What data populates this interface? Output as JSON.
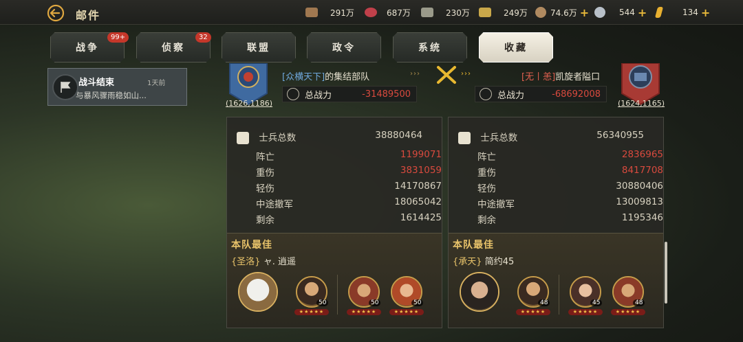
{
  "header": {
    "title": "邮件"
  },
  "resources": [
    {
      "name": "wood-icon",
      "value": "291万",
      "color": "#a07850",
      "plus": false
    },
    {
      "name": "meat-icon",
      "value": "687万",
      "color": "#c0404a",
      "plus": false
    },
    {
      "name": "stone-icon",
      "value": "230万",
      "color": "#9a9a8a",
      "plus": false
    },
    {
      "name": "iron-icon",
      "value": "249万",
      "color": "#c9a84a",
      "plus": false
    },
    {
      "name": "copper-coin-icon",
      "value": "74.6万",
      "color": "#b08a60",
      "plus": true
    },
    {
      "name": "silver-coin-icon",
      "value": "544",
      "color": "#b8c0c8",
      "plus": true
    },
    {
      "name": "gold-ingot-icon",
      "value": "134",
      "color": "#e8b030",
      "plus": true
    }
  ],
  "tabs": [
    {
      "label": "战争",
      "badge": "99+"
    },
    {
      "label": "侦察",
      "badge": "32"
    },
    {
      "label": "联盟",
      "badge": ""
    },
    {
      "label": "政令",
      "badge": ""
    },
    {
      "label": "系统",
      "badge": ""
    },
    {
      "label": "收藏",
      "badge": ""
    }
  ],
  "mail": {
    "title": "战斗结束",
    "time": "1天前",
    "preview": "与暴风骤雨稳如山..."
  },
  "report": {
    "left": {
      "coords": "(1626,1186)",
      "guild_tag": "[众横天下]",
      "name": "的集结部队",
      "power_label": "总战力",
      "power": "-31489500",
      "stats": {
        "total_label": "士兵总数",
        "total": "38880464",
        "rows": [
          {
            "label": "阵亡",
            "value": "1199071",
            "red": true
          },
          {
            "label": "重伤",
            "value": "3831059",
            "red": true
          },
          {
            "label": "轻伤",
            "value": "14170867",
            "red": false
          },
          {
            "label": "中途撤军",
            "value": "18065042",
            "red": false
          },
          {
            "label": "剩余",
            "value": "1614425",
            "red": false
          }
        ]
      },
      "best_label": "本队最佳",
      "best_tag": "{圣洛}",
      "best_name": "ャ. 逍遥",
      "hero_levels": [
        "50",
        "50",
        "50"
      ]
    },
    "right": {
      "coords": "(1624,1165)",
      "guild_tag": "[无丨恙]",
      "name": "凯旋者隘口",
      "power_label": "总战力",
      "power": "-68692008",
      "stats": {
        "total_label": "士兵总数",
        "total": "56340955",
        "rows": [
          {
            "label": "阵亡",
            "value": "2836965",
            "red": true
          },
          {
            "label": "重伤",
            "value": "8417708",
            "red": true
          },
          {
            "label": "轻伤",
            "value": "30880406",
            "red": false
          },
          {
            "label": "中途撤军",
            "value": "13009813",
            "red": false
          },
          {
            "label": "剩余",
            "value": "1195346",
            "red": false
          }
        ]
      },
      "best_label": "本队最佳",
      "best_tag": "{承天}",
      "best_name": "简约45",
      "hero_levels": [
        "48",
        "45",
        "48"
      ]
    }
  },
  "colors": {
    "gold": "#e8c36a",
    "red": "#d94a3e",
    "guild_blue": "#6fa8dc",
    "enemy_red": "#e06050"
  }
}
